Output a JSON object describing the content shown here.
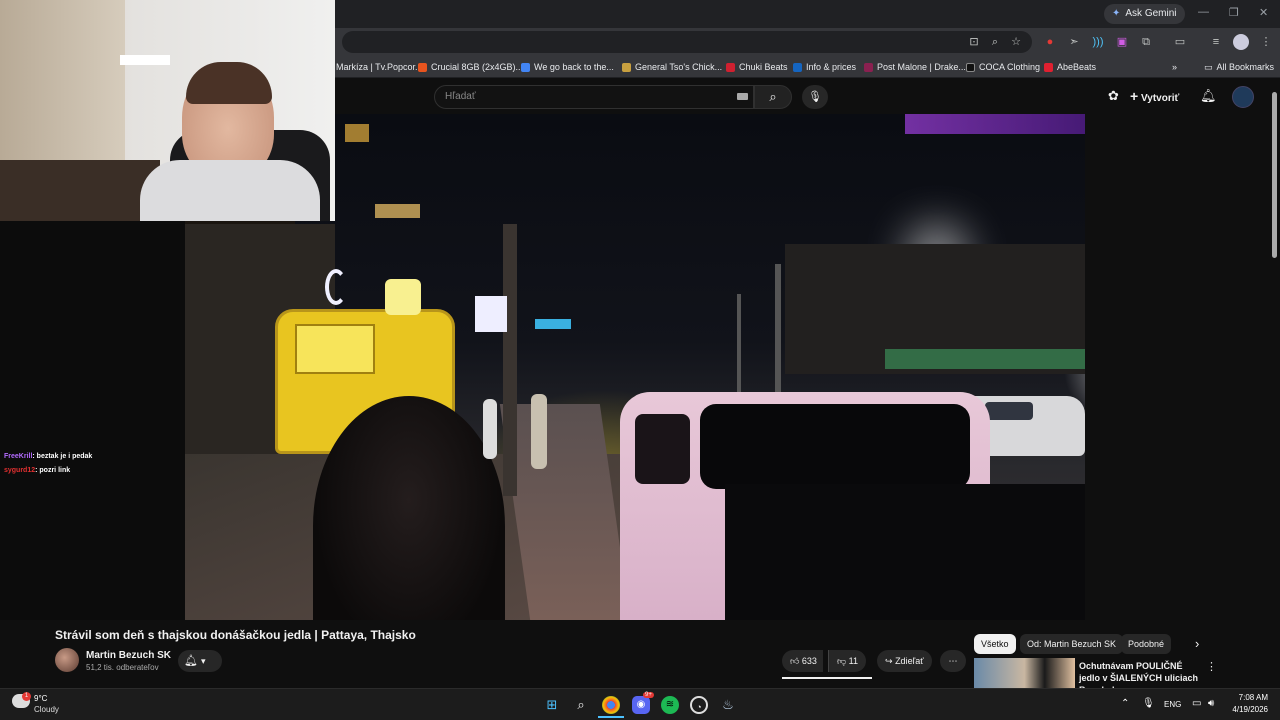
{
  "browser": {
    "ask_gemini": "Ask Gemini",
    "bookmarks": [
      {
        "label": "Markíza | Tv.Popcor...",
        "color": "#2a2a2a"
      },
      {
        "label": "Crucial 8GB (2x4GB)...",
        "color": "#e8541e"
      },
      {
        "label": "We go back to the...",
        "color": "#4285f4"
      },
      {
        "label": "General Tso's Chick...",
        "color": "#c8a040"
      },
      {
        "label": "Chuki Beats",
        "color": "#d02030"
      },
      {
        "label": "Info & prices",
        "color": "#1565c0"
      },
      {
        "label": "Post Malone | Drake...",
        "color": "#8a2050"
      },
      {
        "label": "COCA Clothing",
        "color": "#111111"
      },
      {
        "label": "AbeBeats",
        "color": "#e02030"
      }
    ],
    "all_bookmarks": "All Bookmarks"
  },
  "youtube": {
    "search_placeholder": "Hľadať",
    "create_label": "Vytvoriť",
    "video_title": "Strávil som deň s thajskou donášačkou jedla | Pattaya, Thajsko",
    "channel_name": "Martin Bezuch SK",
    "subscribers": "51,2 tis. odberateľov",
    "likes": "633",
    "dislikes": "11",
    "share_label": "Zdieľať",
    "chips": [
      "Všetko",
      "Od: Martin Bezuch SK",
      "Podobné"
    ],
    "recommended": {
      "title": "Ochutnávam POULIČNÉ jedlo v ŠIALENÝCH uliciach Bangkok..."
    }
  },
  "stream": {
    "chat": [
      {
        "user": "FreeKrill",
        "user_color": "#b36bff",
        "message": ": beztak je i pedak"
      },
      {
        "user": "sygurd12",
        "user_color": "#e03030",
        "message": ": pozri link"
      }
    ]
  },
  "taskbar": {
    "temperature": "9°C",
    "weather": "Cloudy",
    "weather_badge": "1",
    "language": "ENG",
    "time": "7:08 AM",
    "date": "4/19/2026",
    "discord_badge": "9+"
  }
}
